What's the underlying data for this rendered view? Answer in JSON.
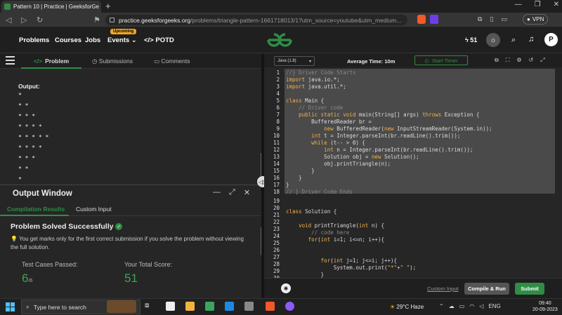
{
  "browser": {
    "tab_title": "Pattern 10 | Practice | GeeksforGe",
    "url_main": "practice.geeksforgeeks.org",
    "url_rest": "/problems/triangle-pattern-1661718013/1?utm_source=youtube&utm_medium...",
    "vpn_label": "VPN"
  },
  "nav": {
    "problems": "Problems",
    "courses": "Courses",
    "jobs": "Jobs",
    "events": "Events",
    "upcoming_badge": "Upcoming",
    "potd": "POTD",
    "streak": "51",
    "avatar_letter": "P"
  },
  "left_tabs": {
    "problem": "Problem",
    "submissions": "Submissions",
    "comments": "Comments"
  },
  "problem": {
    "output_label": "Output:",
    "star_lines": [
      "*",
      "* *",
      "* * *",
      "* * * *",
      "* * * * *",
      "* * * *",
      "* * *",
      "* *",
      "*"
    ]
  },
  "output_window": {
    "title": "Output Window",
    "tab_compile": "Compilation Results",
    "tab_custom": "Custom Input",
    "status": "Problem Solved Successfully",
    "note": "You get marks only for the first correct submission if you solve the problem without viewing the full solution.",
    "tcp_label": "Test Cases Passed:",
    "tcp_value": "6",
    "tcp_total": "/6",
    "score_label": "Your Total Score:",
    "score_value": "51"
  },
  "editor": {
    "language": "Java (1.8)",
    "avg_time": "Average Time: 10m",
    "timer": "Start Timer",
    "custom_input": "Custom Input",
    "compile_run": "Compile & Run",
    "submit": "Submit"
  },
  "taskbar": {
    "search_placeholder": "Type here to search",
    "weather": "29°C  Haze",
    "lang": "ENG",
    "time": "09:40",
    "date": "20-09-2023"
  }
}
